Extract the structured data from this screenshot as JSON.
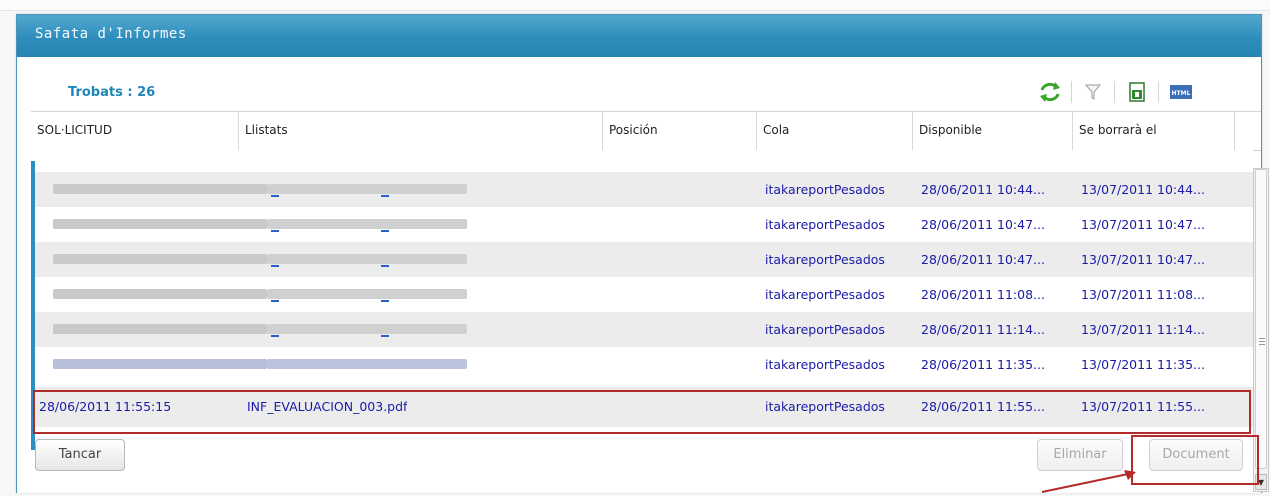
{
  "window": {
    "title": "Safata d'Informes"
  },
  "summary": {
    "found_label": "Trobats : 26"
  },
  "toolbar": {
    "icons": [
      "refresh-icon",
      "filter-icon",
      "excel-export-icon",
      "html-export-icon"
    ],
    "html_badge": "HTML"
  },
  "table": {
    "columns": [
      "SOL·LICITUD",
      "Llistats",
      "Posición",
      "Cola",
      "Disponible",
      "Se borrarà el"
    ],
    "rows": [
      {
        "solicitud": "",
        "llistats": "",
        "posicion": "",
        "cola": "itakareportPesados",
        "disponible": "28/06/2011 10:44...",
        "borrara": "13/07/2011 10:44..."
      },
      {
        "solicitud": "",
        "llistats": "",
        "posicion": "",
        "cola": "itakareportPesados",
        "disponible": "28/06/2011 10:47...",
        "borrara": "13/07/2011 10:47..."
      },
      {
        "solicitud": "",
        "llistats": "",
        "posicion": "",
        "cola": "itakareportPesados",
        "disponible": "28/06/2011 10:47...",
        "borrara": "13/07/2011 10:47..."
      },
      {
        "solicitud": "",
        "llistats": "",
        "posicion": "",
        "cola": "itakareportPesados",
        "disponible": "28/06/2011 11:08...",
        "borrara": "13/07/2011 11:08..."
      },
      {
        "solicitud": "",
        "llistats": "",
        "posicion": "",
        "cola": "itakareportPesados",
        "disponible": "28/06/2011 11:14...",
        "borrara": "13/07/2011 11:14..."
      },
      {
        "solicitud": "",
        "llistats": "",
        "posicion": "",
        "cola": "itakareportPesados",
        "disponible": "28/06/2011 11:35...",
        "borrara": "13/07/2011 11:35..."
      },
      {
        "solicitud": "28/06/2011 11:55:15",
        "llistats": "INF_EVALUACION_003.pdf",
        "posicion": "",
        "cola": "itakareportPesados",
        "disponible": "28/06/2011 11:55...",
        "borrara": "13/07/2011 11:55..."
      }
    ]
  },
  "buttons": {
    "close": "Tancar",
    "delete": "Eliminar",
    "document": "Document"
  },
  "colors": {
    "titlebar": "#2f8dbc",
    "accent": "#1f87b8",
    "link_text": "#1b1ba8",
    "highlight": "#b22a2a"
  }
}
